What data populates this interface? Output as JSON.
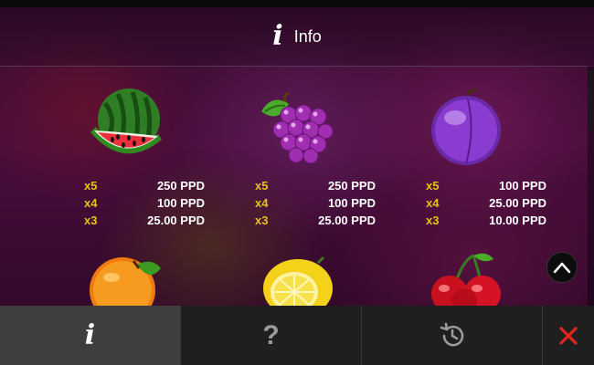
{
  "header": {
    "title": "Info"
  },
  "paytable": [
    {
      "symbol": "watermelon-icon",
      "rows": [
        {
          "mult": "x5",
          "value": "250 PPD"
        },
        {
          "mult": "x4",
          "value": "100 PPD"
        },
        {
          "mult": "x3",
          "value": "25.00 PPD"
        }
      ]
    },
    {
      "symbol": "grapes-icon",
      "rows": [
        {
          "mult": "x5",
          "value": "250 PPD"
        },
        {
          "mult": "x4",
          "value": "100 PPD"
        },
        {
          "mult": "x3",
          "value": "25.00 PPD"
        }
      ]
    },
    {
      "symbol": "plum-icon",
      "rows": [
        {
          "mult": "x5",
          "value": "100 PPD"
        },
        {
          "mult": "x4",
          "value": "25.00 PPD"
        },
        {
          "mult": "x3",
          "value": "10.00 PPD"
        }
      ]
    }
  ],
  "next_row_symbols": [
    "orange-icon",
    "lemon-icon",
    "cherries-icon"
  ],
  "tabs": [
    {
      "name": "info-tab",
      "icon": "info-icon",
      "label": "i"
    },
    {
      "name": "help-tab",
      "icon": "help-icon",
      "label": "?"
    },
    {
      "name": "history-tab",
      "icon": "history-icon"
    },
    {
      "name": "close-tab",
      "icon": "close-icon"
    }
  ],
  "colors": {
    "multiplier": "#e6c21a",
    "close": "#e0261d"
  }
}
